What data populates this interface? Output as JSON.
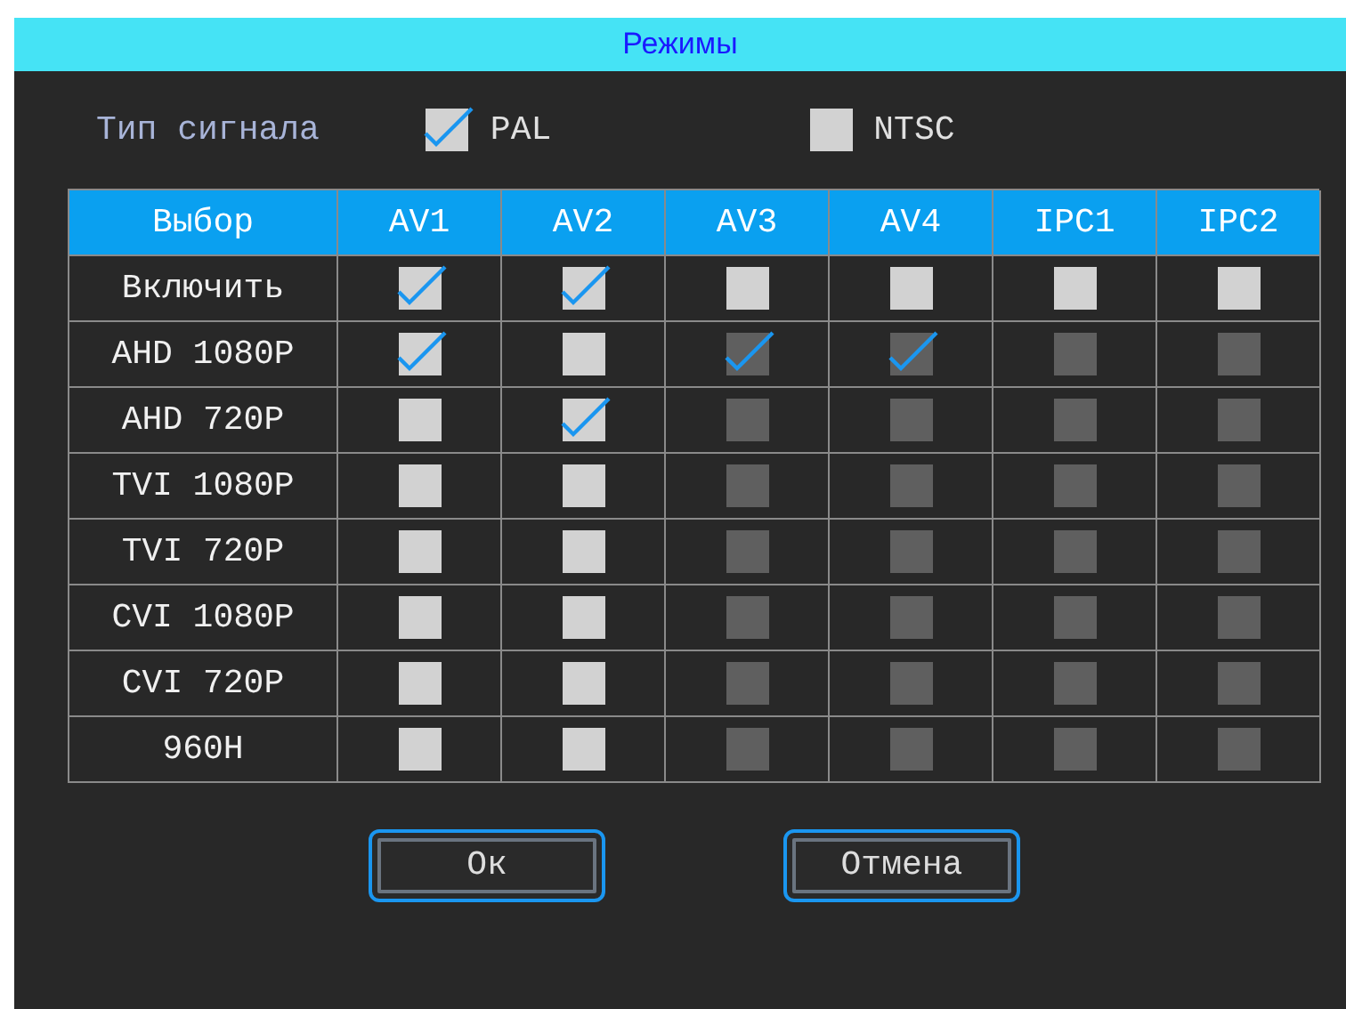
{
  "window": {
    "title": "Режимы"
  },
  "signal": {
    "label": "Тип сигнала",
    "options": [
      {
        "label": "PAL",
        "checked": true
      },
      {
        "label": "NTSC",
        "checked": false
      }
    ]
  },
  "table": {
    "columns": [
      "Выбор",
      "AV1",
      "AV2",
      "AV3",
      "AV4",
      "IPC1",
      "IPC2"
    ],
    "rows": [
      {
        "label": "Включить",
        "cells": [
          {
            "checked": true,
            "disabled": false
          },
          {
            "checked": true,
            "disabled": false
          },
          {
            "checked": false,
            "disabled": false
          },
          {
            "checked": false,
            "disabled": false
          },
          {
            "checked": false,
            "disabled": false
          },
          {
            "checked": false,
            "disabled": false
          }
        ]
      },
      {
        "label": "AHD 1080P",
        "cells": [
          {
            "checked": true,
            "disabled": false
          },
          {
            "checked": false,
            "disabled": false
          },
          {
            "checked": true,
            "disabled": true
          },
          {
            "checked": true,
            "disabled": true
          },
          {
            "checked": false,
            "disabled": true
          },
          {
            "checked": false,
            "disabled": true
          }
        ]
      },
      {
        "label": "AHD 720P",
        "cells": [
          {
            "checked": false,
            "disabled": false
          },
          {
            "checked": true,
            "disabled": false
          },
          {
            "checked": false,
            "disabled": true
          },
          {
            "checked": false,
            "disabled": true
          },
          {
            "checked": false,
            "disabled": true
          },
          {
            "checked": false,
            "disabled": true
          }
        ]
      },
      {
        "label": "TVI 1080P",
        "cells": [
          {
            "checked": false,
            "disabled": false
          },
          {
            "checked": false,
            "disabled": false
          },
          {
            "checked": false,
            "disabled": true
          },
          {
            "checked": false,
            "disabled": true
          },
          {
            "checked": false,
            "disabled": true
          },
          {
            "checked": false,
            "disabled": true
          }
        ]
      },
      {
        "label": "TVI 720P",
        "cells": [
          {
            "checked": false,
            "disabled": false
          },
          {
            "checked": false,
            "disabled": false
          },
          {
            "checked": false,
            "disabled": true
          },
          {
            "checked": false,
            "disabled": true
          },
          {
            "checked": false,
            "disabled": true
          },
          {
            "checked": false,
            "disabled": true
          }
        ]
      },
      {
        "label": "CVI 1080P",
        "cells": [
          {
            "checked": false,
            "disabled": false
          },
          {
            "checked": false,
            "disabled": false
          },
          {
            "checked": false,
            "disabled": true
          },
          {
            "checked": false,
            "disabled": true
          },
          {
            "checked": false,
            "disabled": true
          },
          {
            "checked": false,
            "disabled": true
          }
        ]
      },
      {
        "label": "CVI 720P",
        "cells": [
          {
            "checked": false,
            "disabled": false
          },
          {
            "checked": false,
            "disabled": false
          },
          {
            "checked": false,
            "disabled": true
          },
          {
            "checked": false,
            "disabled": true
          },
          {
            "checked": false,
            "disabled": true
          },
          {
            "checked": false,
            "disabled": true
          }
        ]
      },
      {
        "label": "960H",
        "cells": [
          {
            "checked": false,
            "disabled": false
          },
          {
            "checked": false,
            "disabled": false
          },
          {
            "checked": false,
            "disabled": true
          },
          {
            "checked": false,
            "disabled": true
          },
          {
            "checked": false,
            "disabled": true
          },
          {
            "checked": false,
            "disabled": true
          }
        ]
      }
    ]
  },
  "buttons": [
    "Ок",
    "Отмена"
  ]
}
